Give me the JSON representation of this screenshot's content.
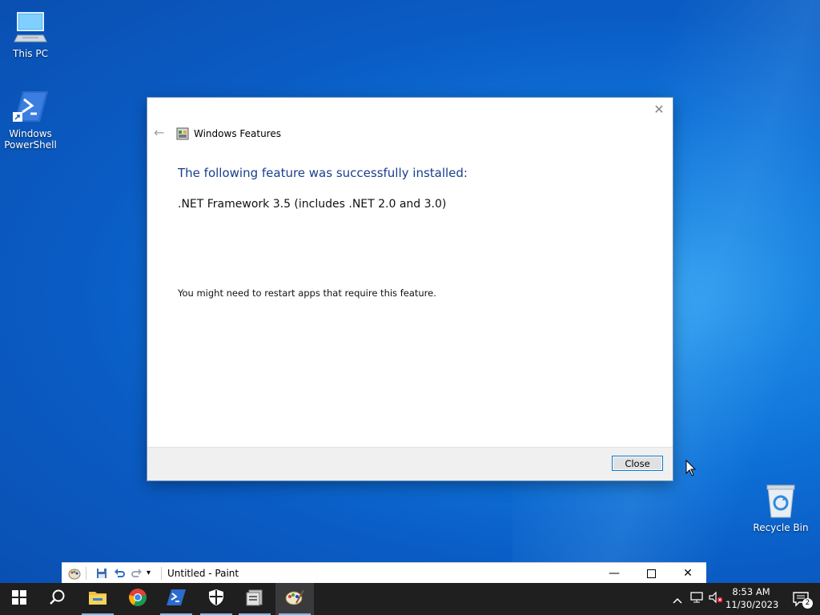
{
  "desktop": {
    "icons": [
      {
        "name": "This PC",
        "icon": "this-pc-icon"
      },
      {
        "name": "Windows PowerShell",
        "icon": "powershell-icon"
      },
      {
        "name": "Recycle Bin",
        "icon": "recycle-bin-icon"
      }
    ],
    "accent": "#0a5cc4"
  },
  "dialog": {
    "title": "Windows Features",
    "heading": "The following feature was successfully installed:",
    "feature": ".NET Framework 3.5 (includes .NET 2.0 and 3.0)",
    "note": "You might need to restart apps that require this feature.",
    "close_button": "Close",
    "heading_color": "#1a3e8c"
  },
  "paint": {
    "title": "Untitled - Paint",
    "quick_access": [
      "save-icon",
      "undo-icon",
      "redo-icon",
      "customize-dropdown-icon"
    ]
  },
  "taskbar": {
    "pinned": [
      {
        "name": "start",
        "icon": "windows-logo-icon"
      },
      {
        "name": "search",
        "icon": "search-icon"
      },
      {
        "name": "file-explorer",
        "icon": "folder-icon"
      },
      {
        "name": "chrome",
        "icon": "chrome-icon"
      },
      {
        "name": "powershell",
        "icon": "powershell-icon"
      },
      {
        "name": "windows-security",
        "icon": "shield-icon"
      },
      {
        "name": "windows-features",
        "icon": "features-icon"
      },
      {
        "name": "paint",
        "icon": "paint-icon"
      }
    ],
    "clock": {
      "time": "8:53 AM",
      "date": "11/30/2023"
    },
    "notification_count": "2"
  }
}
